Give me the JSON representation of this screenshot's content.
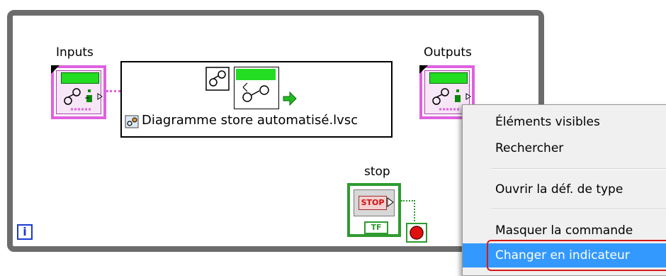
{
  "diagram": {
    "inputs_label": "Inputs",
    "outputs_label": "Outputs",
    "stop_label": "stop",
    "subvi_caption": "Diagramme store automatisé.lvsc",
    "stop_button_text": "STOP",
    "tf_text": "TF",
    "info_text": "i"
  },
  "context_menu": {
    "items": [
      {
        "label": "Éléments visibles"
      },
      {
        "label": "Rechercher"
      },
      {
        "label": "Ouvrir la déf. de type"
      },
      {
        "label": "Masquer la commande"
      },
      {
        "label": "Changer en indicateur"
      }
    ]
  },
  "colors": {
    "frame": "#6c6c6c",
    "cluster_wire": "#e060e0",
    "boolean_green": "#2e9b2e",
    "menu_highlight": "#3399ff"
  }
}
